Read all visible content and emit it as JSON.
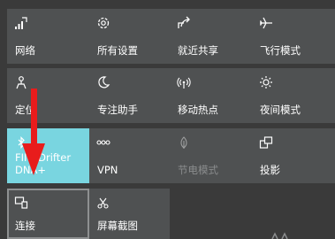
{
  "tiles": [
    {
      "label": "网络",
      "icon": "network-icon"
    },
    {
      "label": "所有设置",
      "icon": "gear-icon"
    },
    {
      "label": "就近共享",
      "icon": "nearby-share-icon"
    },
    {
      "label": "飞行模式",
      "icon": "airplane-icon"
    },
    {
      "label": "定位",
      "icon": "location-icon"
    },
    {
      "label": "专注助手",
      "icon": "moon-icon"
    },
    {
      "label": "移动热点",
      "icon": "hotspot-icon"
    },
    {
      "label": "夜间模式",
      "icon": "brightness-icon"
    },
    {
      "label_line1": "FIIO Drifter",
      "label_line2": "DNA+",
      "icon": "bluetooth-icon",
      "state": "on"
    },
    {
      "label": "VPN",
      "icon": "vpn-icon"
    },
    {
      "label": "节电模式",
      "icon": "battery-saver-icon",
      "state": "disabled"
    },
    {
      "label": "投影",
      "icon": "project-icon"
    },
    {
      "label": "连接",
      "icon": "connect-icon"
    },
    {
      "label": "屏幕截图",
      "icon": "screen-snip-icon"
    }
  ],
  "colors": {
    "background": "#3a3a3a",
    "tile": "#4f5152",
    "active_tile": "#79d5e0",
    "arrow": "#e81c1c"
  }
}
